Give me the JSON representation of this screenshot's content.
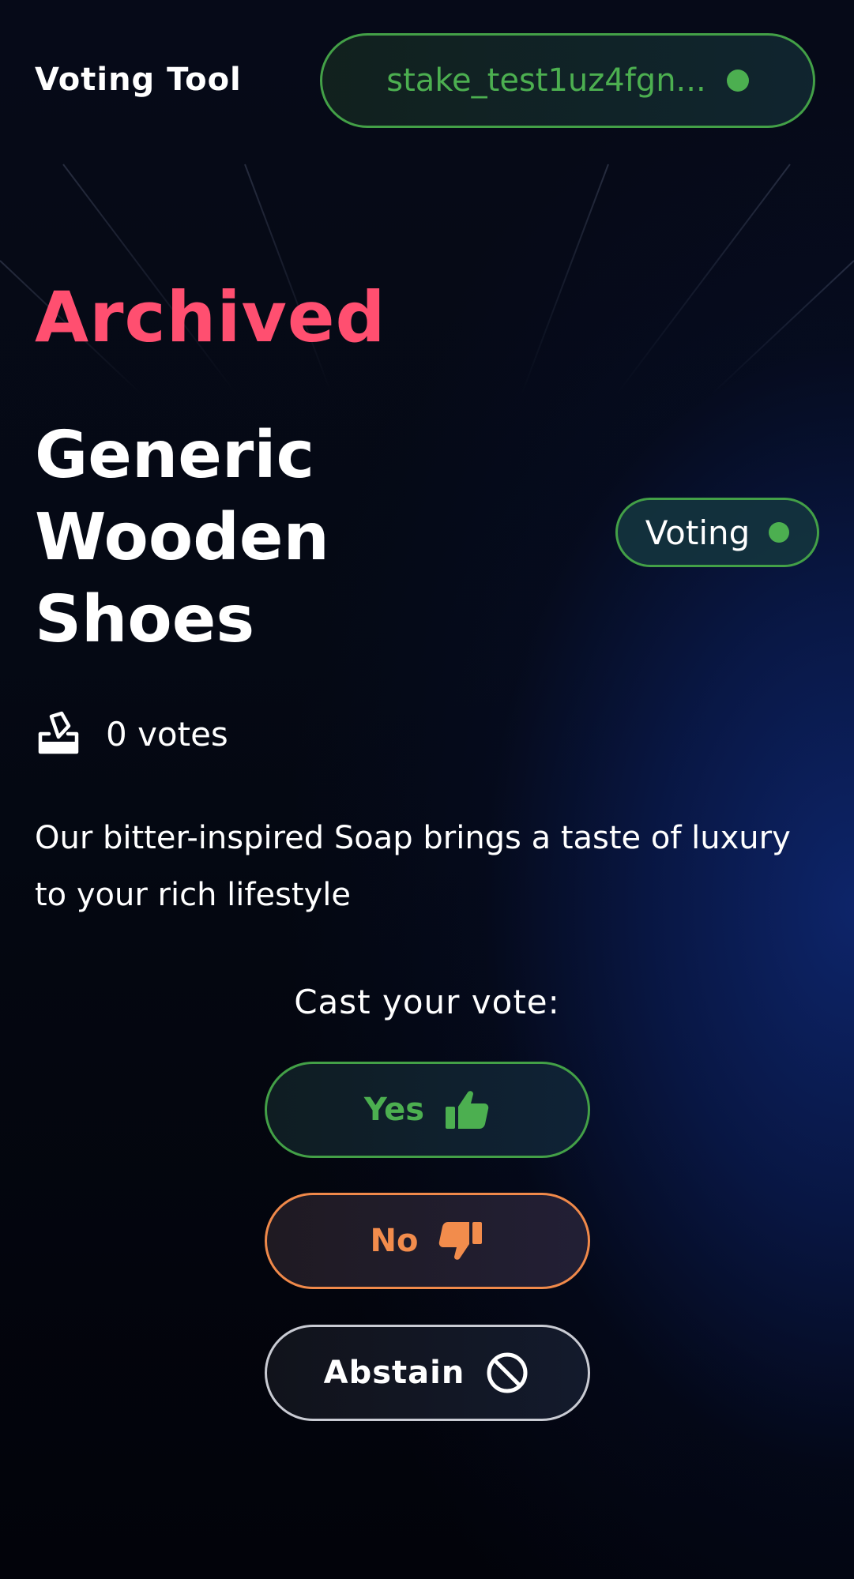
{
  "header": {
    "app_title": "Voting Tool",
    "wallet_address": "stake_test1uz4fgn...",
    "wallet_status_color": "#4caf50"
  },
  "proposal": {
    "state_label": "Archived",
    "state_color": "#ff4f70",
    "title": "Generic Wooden Shoes",
    "status_badge": "Voting",
    "votes_text": "0 votes",
    "description": "Our bitter-inspired Soap brings a taste of luxury to your rich lifestyle"
  },
  "vote_panel": {
    "prompt": "Cast your vote:",
    "options": [
      {
        "label": "Yes",
        "icon": "thumbs-up-icon",
        "color": "#4caf50"
      },
      {
        "label": "No",
        "icon": "thumbs-down-icon",
        "color": "#f28c4c"
      },
      {
        "label": "Abstain",
        "icon": "ban-icon",
        "color": "#ffffff"
      }
    ]
  }
}
